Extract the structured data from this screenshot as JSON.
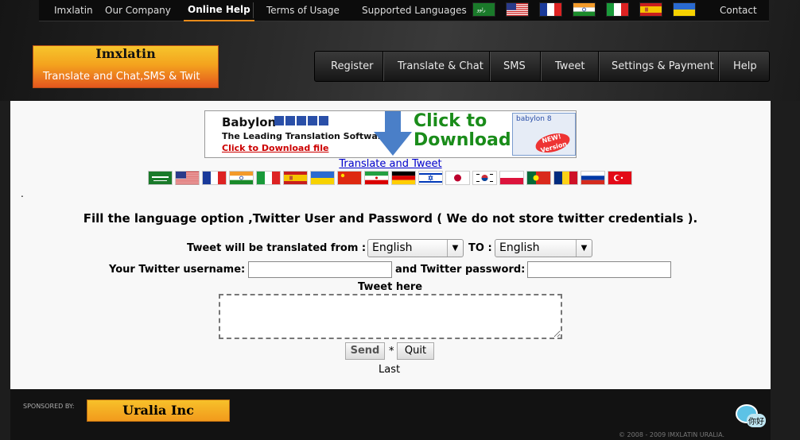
{
  "top_nav": {
    "items": [
      "Imxlatin",
      "Our Company",
      "Online Help",
      "Terms of Usage",
      "Supported Languages"
    ],
    "active": "Online Help",
    "contact": "Contact",
    "flags": [
      "arabic",
      "usa",
      "france",
      "india",
      "italy",
      "spain",
      "ukraine"
    ]
  },
  "logo": {
    "title": "Imxlatin",
    "tagline": "Translate and Chat,SMS & Twit"
  },
  "main_nav": {
    "items": [
      "Register",
      "Translate & Chat",
      "SMS",
      "Tweet",
      "Settings & Payment",
      "Help"
    ]
  },
  "banner": {
    "brand": "Babylon",
    "line1": "The Leading Translation Software",
    "link": "Click to Download file",
    "cta_line1": "Click to",
    "cta_line2": "Download",
    "box_title": "babylon 8",
    "badge": "NEW! Version"
  },
  "translate_link": "Translate and Tweet",
  "language_flags": [
    "arabic",
    "usa",
    "france",
    "india",
    "italy",
    "spain",
    "ukraine",
    "china",
    "iran",
    "germany",
    "israel",
    "japan",
    "korea",
    "poland",
    "portugal",
    "romania",
    "russia",
    "turkey"
  ],
  "dot": ".",
  "heading": "Fill the language option ,Twitter User and Password ( We do not store twitter credentials ).",
  "form": {
    "from_label": "Tweet will be translated from :",
    "from_value": "English",
    "to_label": "TO :",
    "to_value": "English",
    "username_label": "Your Twitter username:",
    "password_label": "and Twitter password:",
    "tweet_label": "Tweet here",
    "send": "Send",
    "separator": "*",
    "quit": "Quit",
    "last": "Last"
  },
  "footer": {
    "sponsored": "SPONSORED BY:",
    "sponsor": "Uralia Inc",
    "copyright": "© 2008 - 2009 IMXLATIN URALIA.",
    "chat_text": "你好"
  },
  "colors": {
    "accent_orange": "#f4a31e",
    "link_blue": "#0000cc",
    "dark_bg": "#1d1d1d"
  }
}
